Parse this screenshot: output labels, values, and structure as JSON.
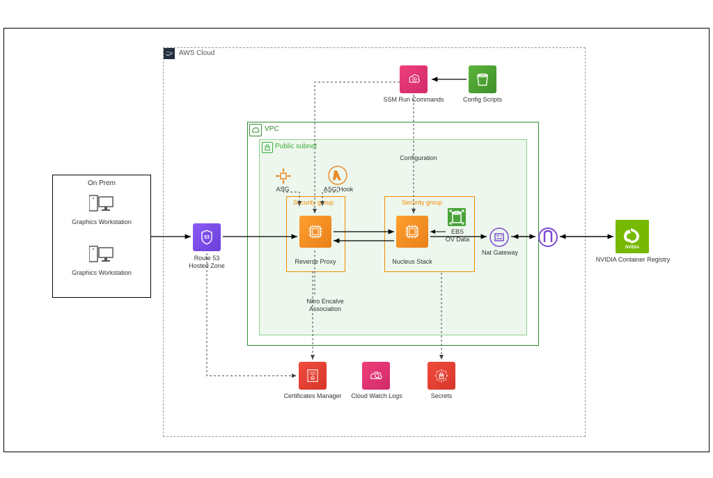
{
  "outer": {
    "label": ""
  },
  "onprem": {
    "title": "On Prem",
    "ws1": "Graphics Workstation",
    "ws2": "Graphics Workstation"
  },
  "aws": {
    "title": "AWS Cloud",
    "route53": "Route 53\nHosted Zone",
    "ssm": "SSM Run Commands",
    "config_scripts": "Config Scripts",
    "vpc": "VPC",
    "public_subnet": "Public subnet",
    "asg": "ASG",
    "asg_hook": "ASG Hook",
    "sg1": "Security group",
    "sg2": "Security group",
    "reverse_proxy": "Reverse Proxy",
    "nucleus_stack": "Nucleus Stack",
    "ebs": "EBS\nOV Data",
    "nat": "Nat Gateway",
    "nitro": "Nitro Encalve\nAssociation",
    "cert_mgr": "Certificates Manager",
    "cw_logs": "Cloud Watch Logs",
    "secrets": "Secrets",
    "configuration": "Configuration",
    "gateway_icon": "gateway"
  },
  "nvidia": {
    "title": "NVIDIA Container Registry",
    "logo_text": "NVIDIA"
  }
}
